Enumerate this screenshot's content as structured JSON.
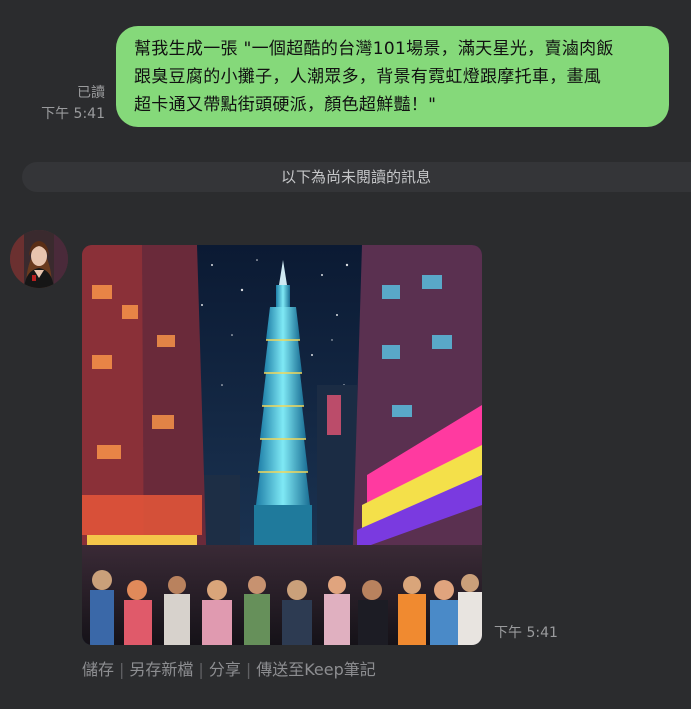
{
  "sent_message": {
    "read_status": "已讀",
    "time": "下午 5:41",
    "lines": [
      "幫我生成一張 \"一個超酷的台灣101場景，滿天星光，賣滷肉飯",
      "跟臭豆腐的小攤子，人潮眾多，背景有霓虹燈跟摩托車，畫風",
      "超卡通又帶點街頭硬派，顏色超鮮豔！\""
    ],
    "bubble_color": "#85d97a"
  },
  "divider": {
    "label": "以下為尚未閱讀的訊息"
  },
  "received_message": {
    "avatar_icon": "avatar-woman",
    "image_icon": "taipei-101-night-market-image",
    "time": "下午 5:41"
  },
  "actions": [
    {
      "label": "儲存"
    },
    {
      "label": "另存新檔"
    },
    {
      "label": "分享"
    },
    {
      "label": "傳送至Keep筆記"
    }
  ],
  "colors": {
    "background": "#2b2c2e",
    "divider": "#343538"
  }
}
